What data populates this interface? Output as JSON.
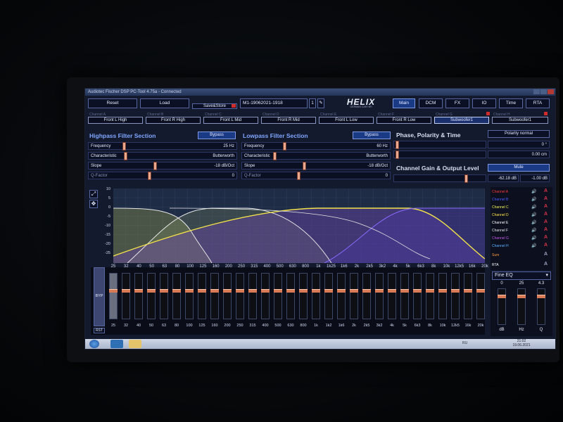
{
  "window": {
    "title": "Audiotec Fischer DSP PC-Tool 4.75a - Connected"
  },
  "toolbar": {
    "reset": "Reset",
    "load": "Load",
    "savestore": "Save&Store",
    "device": "M1-19062021-1918",
    "slot": "1",
    "logo": "HELIX",
    "logo_sub": "GERMAN CAR HiFi"
  },
  "tabs": [
    "Main",
    "DCM",
    "FX",
    "IO",
    "Time",
    "RTA"
  ],
  "channels": [
    {
      "label": "Channel A",
      "name": "Front L High"
    },
    {
      "label": "Channel B",
      "name": "Front R High"
    },
    {
      "label": "Channel C",
      "name": "Front L Mid"
    },
    {
      "label": "Channel D",
      "name": "Front R Mid"
    },
    {
      "label": "Channel E",
      "name": "Front L Low"
    },
    {
      "label": "Channel F",
      "name": "Front R Low"
    },
    {
      "label": "Channel G",
      "name": "Subwoofer1"
    },
    {
      "label": "Channel H",
      "name": "Subwoofer1"
    }
  ],
  "highpass": {
    "title": "Highpass Filter Section",
    "bypass": "Bypass",
    "rows": [
      {
        "label": "Frequency",
        "value": "25 Hz"
      },
      {
        "label": "Characteristic",
        "value": "Butterworth"
      },
      {
        "label": "Slope",
        "value": "-18 dB/Oct"
      },
      {
        "label": "Q-Factor",
        "value": "0"
      }
    ]
  },
  "lowpass": {
    "title": "Lowpass Filter Section",
    "bypass": "Bypass",
    "rows": [
      {
        "label": "Frequency",
        "value": "60 Hz"
      },
      {
        "label": "Characteristic",
        "value": "Butterworth"
      },
      {
        "label": "Slope",
        "value": "-18 dB/Oct"
      },
      {
        "label": "Q-Factor",
        "value": "0"
      }
    ]
  },
  "phase": {
    "title": "Phase, Polarity & Time",
    "polarity": "Polarity normal",
    "phase_value": "0 °",
    "time_value": "0.00 cm"
  },
  "gain": {
    "title": "Channel Gain & Output Level",
    "mute": "Mute",
    "gain_value": "-62.18 dB",
    "output_value": "-1.00 dB"
  },
  "legend": [
    {
      "name": "Channel A",
      "color": "#ff3b3b"
    },
    {
      "name": "Channel B",
      "color": "#4a5bff"
    },
    {
      "name": "Channel C",
      "color": "#f2f25a"
    },
    {
      "name": "Channel D",
      "color": "#ffe14a"
    },
    {
      "name": "Channel E",
      "color": "#ffffff"
    },
    {
      "name": "Channel F",
      "color": "#e6e6e6"
    },
    {
      "name": "Channel G",
      "color": "#c45ae6"
    },
    {
      "name": "Channel H",
      "color": "#5ab4ff"
    },
    {
      "name": "Sum",
      "color": "#ff9a3a"
    },
    {
      "name": "RTA",
      "color": "#ffffff"
    }
  ],
  "plot": {
    "y_ticks": [
      "10",
      "5",
      "0",
      "-5",
      "-10",
      "-15",
      "-20",
      "-25"
    ],
    "x_ticks": [
      "25",
      "32",
      "40",
      "50",
      "63",
      "80",
      "100",
      "125",
      "160",
      "200",
      "250",
      "315",
      "400",
      "500",
      "630",
      "800",
      "1k",
      "1k25",
      "1k6",
      "2k",
      "2k5",
      "3k2",
      "4k",
      "5k",
      "6k3",
      "8k",
      "10k",
      "12k5",
      "16k",
      "20k"
    ]
  },
  "eq": {
    "byp": "BYP",
    "rst": "RST",
    "bands": [
      "25",
      "32",
      "40",
      "50",
      "63",
      "80",
      "100",
      "125",
      "160",
      "200",
      "250",
      "315",
      "400",
      "500",
      "630",
      "800",
      "1k",
      "1k2",
      "1k6",
      "2k",
      "2k5",
      "3k2",
      "4k",
      "5k",
      "6k3",
      "8k",
      "10k",
      "12k5",
      "16k",
      "20k"
    ]
  },
  "fine_eq": {
    "title": "Fine EQ",
    "values": [
      "0",
      "25",
      "4.3"
    ],
    "labels": [
      "dB",
      "Hz",
      "Q"
    ]
  },
  "taskbar": {
    "lang": "RU",
    "time": "21:02",
    "date": "19.06.2021"
  }
}
